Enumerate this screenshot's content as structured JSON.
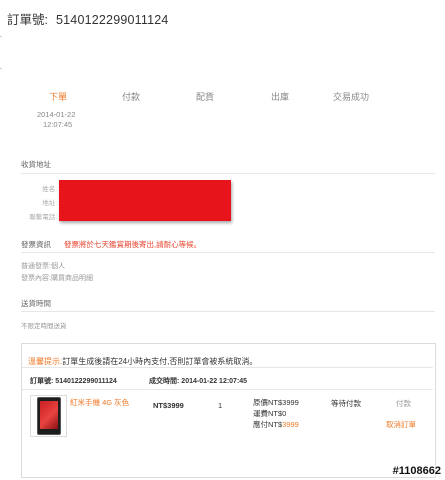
{
  "order": {
    "label": "訂單號:",
    "number": "5140122299011124"
  },
  "steps": [
    {
      "label": "下單",
      "time_date": "2014-01-22",
      "time_clock": "12:07:45",
      "active": true
    },
    {
      "label": "付款"
    },
    {
      "label": "配貨"
    },
    {
      "label": "出庫"
    },
    {
      "label": "交易成功"
    }
  ],
  "shipping": {
    "title": "收貨地址",
    "fields": [
      "姓名:",
      "地址:",
      "聯繫電話:"
    ]
  },
  "invoice": {
    "title": "發票資訊",
    "warning": "發票將於七天鑑賞期後寄出,請耐心等候。",
    "type": "普通發票:個人",
    "content": "發票內容:購買商品明細"
  },
  "delivery": {
    "title": "送貨時間",
    "value": "不限定時間送貨"
  },
  "notice": {
    "label": "溫馨提示:",
    "text": "訂單生成後請在24小時內支付,否則訂單會被系統取消。"
  },
  "table": {
    "order_label": "訂單號:",
    "order_number": "5140122299011124",
    "time_label": "成交時間:",
    "time_value": "2014-01-22 12:07:45"
  },
  "item": {
    "name": "紅米手機 4G 灰色",
    "price": "NT$3999",
    "quantity": "1",
    "original": "原價NT$3999",
    "shipping": "運費NT$0",
    "payable_label": "應付NT$",
    "payable_value": "3999",
    "status": "等待付款",
    "pay_link": "付款",
    "cancel_link": "取消訂單"
  },
  "watermark": "#1108662",
  "colors": {
    "accent": "#f07a28",
    "warning": "#e9452f",
    "redacted": "#e8141b"
  }
}
